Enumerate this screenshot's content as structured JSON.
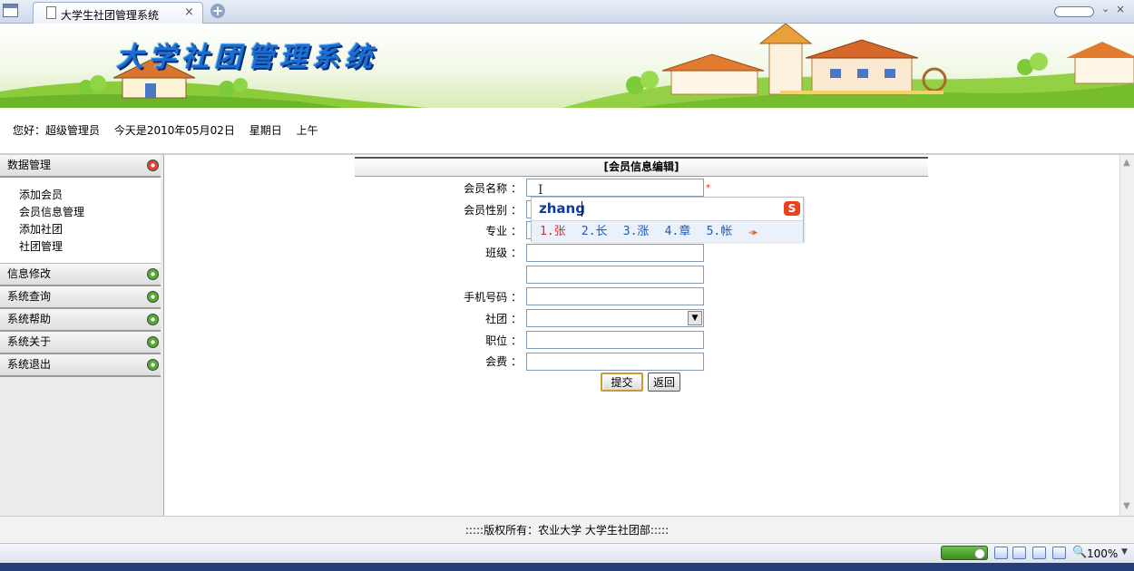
{
  "browser": {
    "tab_title": "大学生社团管理系统",
    "tab_close": "×",
    "new_tab": "+",
    "menu_chevron": "⌄",
    "window_close": "×"
  },
  "banner": {
    "title": "大学社团管理系统"
  },
  "greeting": {
    "hello": "您好：超级管理员",
    "today": "今天是2010年05月02日",
    "weekday": "星期日",
    "period": "上午"
  },
  "sidebar": {
    "menus": [
      {
        "label": "数据管理",
        "expanded": true
      },
      {
        "label": "信息修改",
        "expanded": false
      },
      {
        "label": "系统查询",
        "expanded": false
      },
      {
        "label": "系统帮助",
        "expanded": false
      },
      {
        "label": "系统关于",
        "expanded": false
      },
      {
        "label": "系统退出",
        "expanded": false
      }
    ],
    "submenu": [
      "添加会员",
      "会员信息管理",
      "添加社团",
      "社团管理"
    ]
  },
  "form": {
    "header": "[会员信息编辑]",
    "labels": {
      "name": "会员名称 ：",
      "gender": "会员性别 ：",
      "major": "专业 ：",
      "class": "班级 ：",
      "phone": "手机号码 ：",
      "club": "社团 ：",
      "position": "职位 ：",
      "fee": "会费 ："
    },
    "required_mark": "*",
    "submit_label": "提交",
    "back_label": "返回"
  },
  "ime": {
    "input": "zhang",
    "logo": "S",
    "candidates": [
      "1.张",
      "2.长",
      "3.涨",
      "4.章",
      "5.帐"
    ]
  },
  "footer": {
    "copyright": ":::::版权所有：农业大学 大学生社团部:::::"
  },
  "status": {
    "zoom": "100%"
  },
  "colors": {
    "banner_title": "#1a6fd1",
    "required": "#e02020",
    "ime_first": "#e12a2a",
    "ime_candidate": "#1e5bb8"
  }
}
